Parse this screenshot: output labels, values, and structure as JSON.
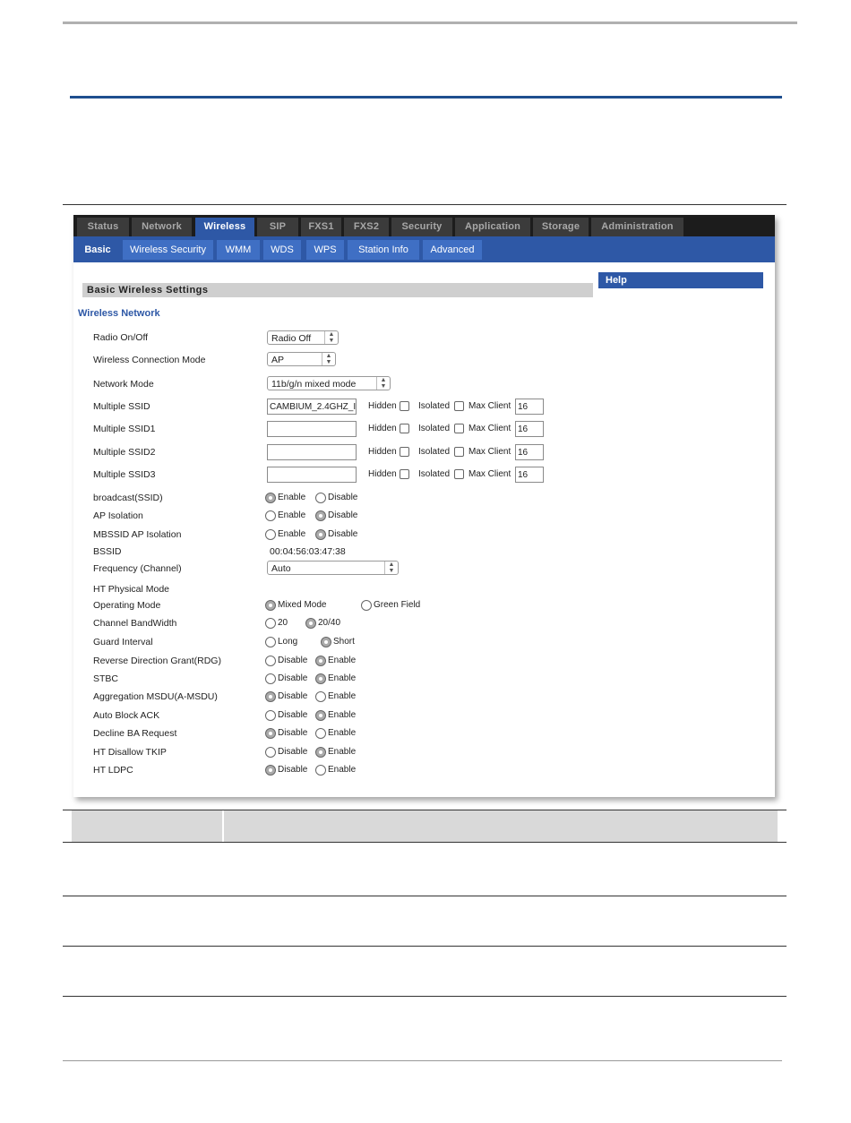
{
  "main_nav": [
    "Status",
    "Network",
    "Wireless",
    "SIP",
    "FXS1",
    "FXS2",
    "Security",
    "Application",
    "Storage",
    "Administration"
  ],
  "sub_nav": [
    "Basic",
    "Wireless Security",
    "WMM",
    "WDS",
    "WPS",
    "Station Info",
    "Advanced"
  ],
  "section_title": "Basic Wireless Settings",
  "help_title": "Help",
  "wireless_network_label": "Wireless Network",
  "fields": {
    "radio": {
      "label": "Radio On/Off",
      "value": "Radio Off"
    },
    "conn_mode": {
      "label": "Wireless Connection Mode",
      "value": "AP"
    },
    "net_mode": {
      "label": "Network Mode",
      "value": "11b/g/n mixed mode"
    },
    "frequency": {
      "label": "Frequency (Channel)",
      "value": "Auto"
    },
    "bssid": {
      "label": "BSSID",
      "value": "00:04:56:03:47:38"
    },
    "ht_physical": {
      "label": "HT Physical Mode"
    }
  },
  "ssids": [
    {
      "label": "Multiple SSID",
      "value": "CAMBIUM_2.4GHZ_I",
      "max": "16"
    },
    {
      "label": "Multiple SSID1",
      "value": "",
      "max": "16"
    },
    {
      "label": "Multiple SSID2",
      "value": "",
      "max": "16"
    },
    {
      "label": "Multiple SSID3",
      "value": "",
      "max": "16"
    }
  ],
  "ssid_opts": {
    "hidden": "Hidden",
    "isolated": "Isolated",
    "max_client": "Max Client"
  },
  "radio_rows": {
    "broadcast": {
      "label": "broadcast(SSID)",
      "a": "Enable",
      "b": "Disable"
    },
    "ap_isolation": {
      "label": "AP Isolation",
      "a": "Enable",
      "b": "Disable"
    },
    "mbssid": {
      "label": "MBSSID AP Isolation",
      "a": "Enable",
      "b": "Disable"
    },
    "op_mode": {
      "label": "Operating Mode",
      "a": "Mixed Mode",
      "b": "Green Field"
    },
    "bandwidth": {
      "label": "Channel BandWidth",
      "a": "20",
      "b": "20/40"
    },
    "guard": {
      "label": "Guard Interval",
      "a": "Long",
      "b": "Short"
    },
    "rdg": {
      "label": "Reverse Direction Grant(RDG)",
      "a": "Disable",
      "b": "Enable"
    },
    "stbc": {
      "label": "STBC",
      "a": "Disable",
      "b": "Enable"
    },
    "amsdu": {
      "label": "Aggregation MSDU(A-MSDU)",
      "a": "Disable",
      "b": "Enable"
    },
    "autoblock": {
      "label": "Auto Block ACK",
      "a": "Disable",
      "b": "Enable"
    },
    "decline": {
      "label": "Decline BA Request",
      "a": "Disable",
      "b": "Enable"
    },
    "tkip": {
      "label": "HT Disallow TKIP",
      "a": "Disable",
      "b": "Enable"
    },
    "ldpc": {
      "label": "HT LDPC",
      "a": "Disable",
      "b": "Enable"
    }
  },
  "colors": {
    "nav_blue": "#2e58a6",
    "nav_dark": "#1c1c1c",
    "header_rule": "#1f4f8f"
  }
}
